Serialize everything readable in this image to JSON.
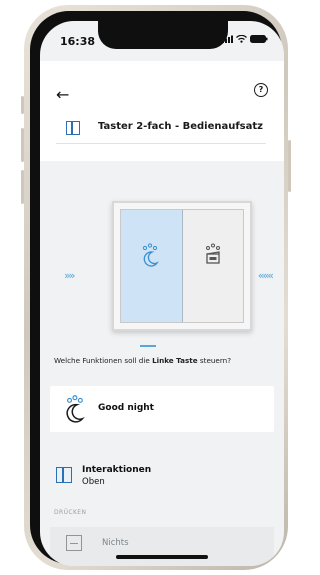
{
  "status_bar": {
    "time": "16:38"
  },
  "header": {
    "title": "Taster 2-fach - Bedienaufsatz"
  },
  "switch": {
    "left_key_icon": "good-night-scene-icon",
    "right_key_icon": "scene-clapper-icon",
    "left_arrows": "»»",
    "right_arrows": "«««"
  },
  "question": {
    "prefix": "Welche Funktionen soll die ",
    "key": "Linke Taste",
    "suffix": " steuern?"
  },
  "selected_function": {
    "label": "Good night",
    "icon": "good-night-scene-icon"
  },
  "interactions": {
    "title": "Interaktionen",
    "subtitle": "Oben"
  },
  "press_section": {
    "label": "DRÜCKEN"
  },
  "press_option": {
    "label": "Nichts"
  },
  "colors": {
    "accent": "#2c6fb2",
    "light_blue": "#cfe3f6",
    "arrow_blue": "#5aa6d8"
  }
}
